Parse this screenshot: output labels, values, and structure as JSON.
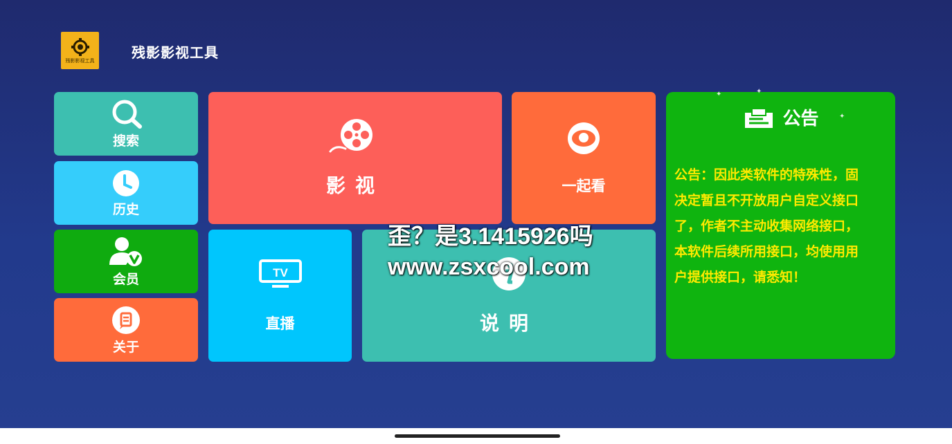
{
  "app": {
    "title": "残影影视工具",
    "logo_text": "残影影视工具"
  },
  "tiles": {
    "search": {
      "label": "搜索",
      "icon": "search-icon"
    },
    "history": {
      "label": "历史",
      "icon": "clock-icon"
    },
    "vip": {
      "label": "会员",
      "icon": "vip-user-icon"
    },
    "about": {
      "label": "关于",
      "icon": "about-icon"
    },
    "movie": {
      "label": "影视",
      "icon": "film-reel-icon"
    },
    "together": {
      "label": "一起看",
      "icon": "eye-icon"
    },
    "live": {
      "label": "直播",
      "icon": "tv-icon"
    },
    "info": {
      "label": "说明",
      "icon": "info-icon"
    }
  },
  "notice": {
    "title": "公告",
    "lines": [
      "公告：因此类软件的特殊性，固",
      "决定暂且不开放用户自定义接口",
      "了，作者不主动收集网络接口，",
      "本软件后续所用接口，均使用用",
      "户提供接口，请悉知！"
    ]
  },
  "watermark": {
    "line1": "歪？是3.1415926吗",
    "line2": "www.zsxcool.com"
  },
  "colors": {
    "background": "#223a8c",
    "search": "#3dbfb0",
    "history": "#35cdfb",
    "vip": "#0fab0f",
    "about": "#ff6b3b",
    "movie": "#fd5f59",
    "together": "#ff6b3b",
    "live": "#00c6fd",
    "info": "#3dbfb0",
    "notice": "#0fb40f",
    "notice_text": "#ffea00"
  }
}
